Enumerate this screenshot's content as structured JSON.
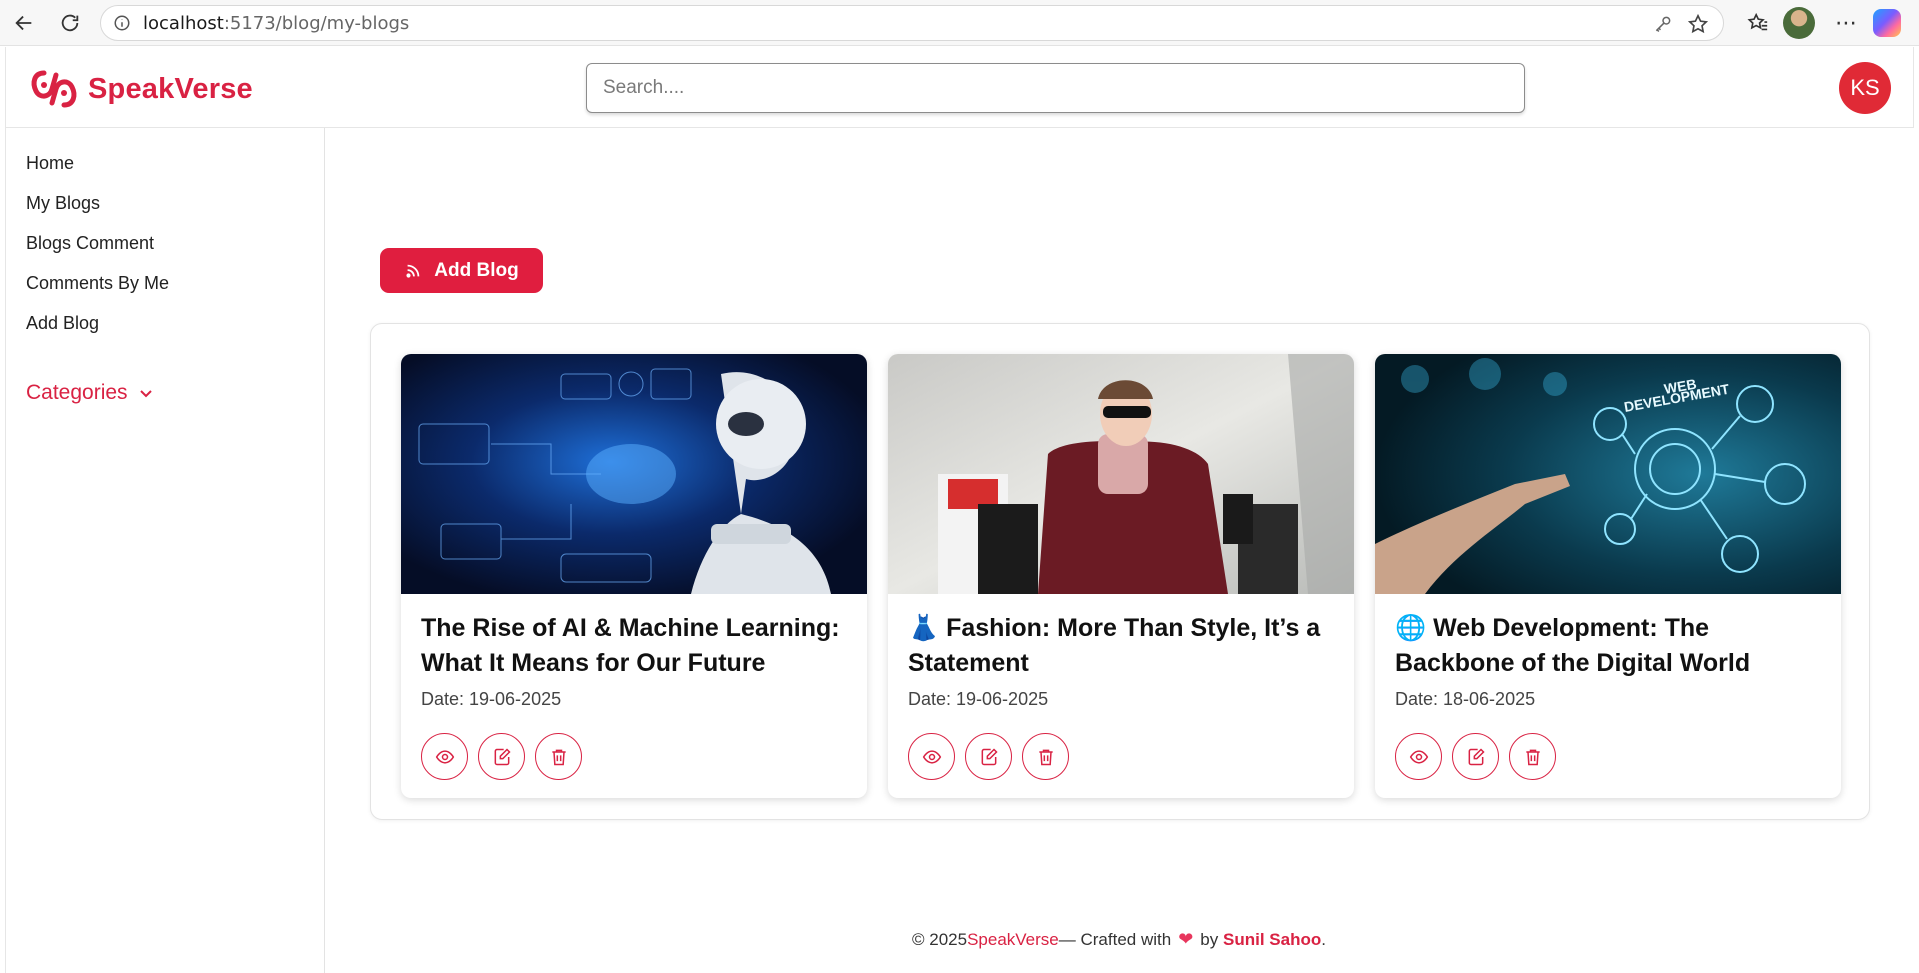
{
  "browser": {
    "url_host": "localhost",
    "url_path": ":5173/blog/my-blogs"
  },
  "header": {
    "brand": "SpeakVerse",
    "search_placeholder": "Search....",
    "avatar_initials": "KS"
  },
  "sidebar": {
    "items": [
      {
        "label": "Home"
      },
      {
        "label": "My Blogs"
      },
      {
        "label": "Blogs Comment"
      },
      {
        "label": "Comments By Me"
      },
      {
        "label": "Add Blog"
      }
    ],
    "categories_label": "Categories"
  },
  "main": {
    "add_blog_label": "Add Blog",
    "blogs": [
      {
        "title": "The Rise of AI & Machine Learning: What It Means for Our Future",
        "date": "Date: 19-06-2025"
      },
      {
        "title": "👗 Fashion: More Than Style, It’s a Statement",
        "date": "Date: 19-06-2025"
      },
      {
        "title": "🌐 Web Development: The Backbone of the Digital World",
        "date": "Date: 18-06-2025"
      }
    ]
  },
  "footer": {
    "copyright": "© 2025",
    "brand": "SpeakVerse",
    "crafted": "— Crafted with",
    "by": "by",
    "author": "Sunil Sahoo",
    "period": "."
  },
  "colors": {
    "brand": "#d92243",
    "button": "#e01e3f",
    "avatar": "#e02a36"
  }
}
